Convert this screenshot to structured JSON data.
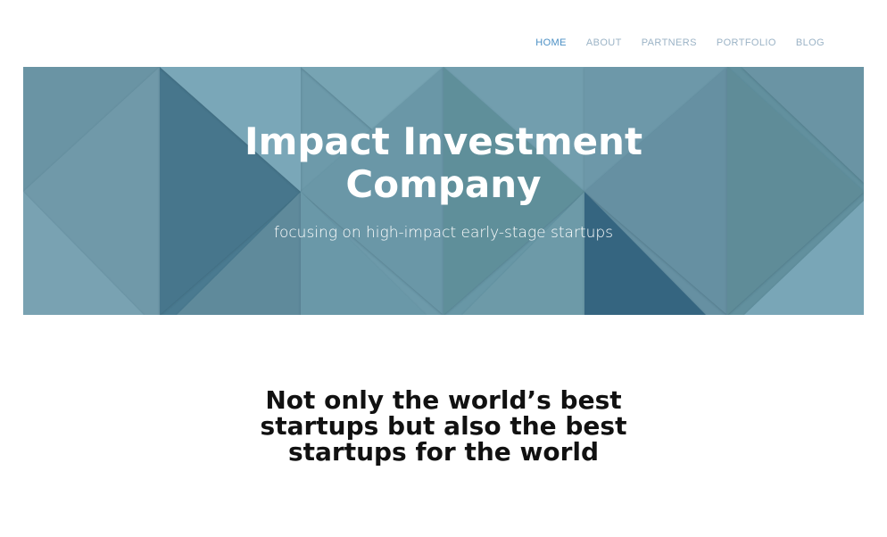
{
  "nav": {
    "items": [
      {
        "label": "HOME",
        "active": true
      },
      {
        "label": "ABOUT",
        "active": false
      },
      {
        "label": "PARTNERS",
        "active": false
      },
      {
        "label": "PORTFOLIO",
        "active": false
      },
      {
        "label": "BLOG",
        "active": false
      }
    ],
    "color": "#9bb3c6",
    "active_color": "#4a8fc4"
  },
  "hero": {
    "title_line1": "Impact Investment",
    "title_line2": "Company",
    "subtitle": "focusing on high-impact early-stage startups",
    "background_color": "#6e97a6"
  },
  "tagline": {
    "line1": "Not only the world’s best",
    "line2": "startups but also the best",
    "line3": "startups for the world"
  }
}
